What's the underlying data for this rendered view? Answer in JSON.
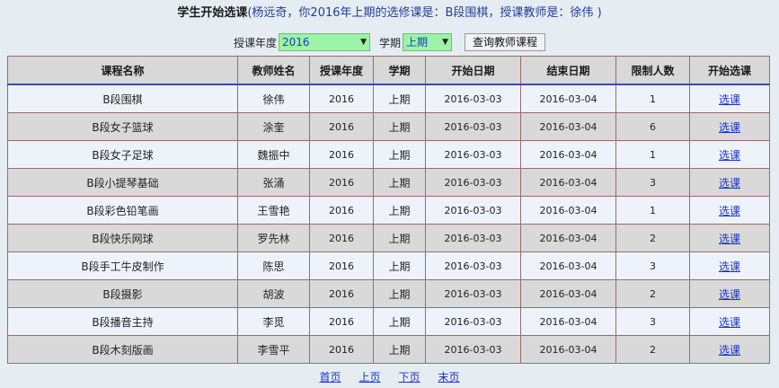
{
  "header": {
    "title": "学生开始选课",
    "note": "(杨远奇，你2016年上期的选修课是：B段围棋，授课教师是：徐伟 )"
  },
  "filters": {
    "year_label": "授课年度",
    "year_value": "2016",
    "term_label": "学期",
    "term_value": "上期",
    "query_button": "查询教师课程"
  },
  "table": {
    "columns": [
      "课程名称",
      "教师姓名",
      "授课年度",
      "学期",
      "开始日期",
      "结束日期",
      "限制人数",
      "开始选课"
    ],
    "rows": [
      {
        "course": "B段围棋",
        "teacher": "徐伟",
        "year": "2016",
        "term": "上期",
        "start": "2016-03-03",
        "end": "2016-03-04",
        "limit": "1",
        "action": "选课"
      },
      {
        "course": "B段女子篮球",
        "teacher": "涂奎",
        "year": "2016",
        "term": "上期",
        "start": "2016-03-03",
        "end": "2016-03-04",
        "limit": "6",
        "action": "选课"
      },
      {
        "course": "B段女子足球",
        "teacher": "魏振中",
        "year": "2016",
        "term": "上期",
        "start": "2016-03-03",
        "end": "2016-03-04",
        "limit": "1",
        "action": "选课"
      },
      {
        "course": "B段小提琴基础",
        "teacher": "张涌",
        "year": "2016",
        "term": "上期",
        "start": "2016-03-03",
        "end": "2016-03-04",
        "limit": "3",
        "action": "选课"
      },
      {
        "course": "B段彩色铅笔画",
        "teacher": "王雪艳",
        "year": "2016",
        "term": "上期",
        "start": "2016-03-03",
        "end": "2016-03-04",
        "limit": "1",
        "action": "选课"
      },
      {
        "course": "B段快乐网球",
        "teacher": "罗先林",
        "year": "2016",
        "term": "上期",
        "start": "2016-03-03",
        "end": "2016-03-04",
        "limit": "2",
        "action": "选课"
      },
      {
        "course": "B段手工牛皮制作",
        "teacher": "陈思",
        "year": "2016",
        "term": "上期",
        "start": "2016-03-03",
        "end": "2016-03-04",
        "limit": "3",
        "action": "选课"
      },
      {
        "course": "B段摄影",
        "teacher": "胡波",
        "year": "2016",
        "term": "上期",
        "start": "2016-03-03",
        "end": "2016-03-04",
        "limit": "2",
        "action": "选课"
      },
      {
        "course": "B段播音主持",
        "teacher": "李觅",
        "year": "2016",
        "term": "上期",
        "start": "2016-03-03",
        "end": "2016-03-04",
        "limit": "3",
        "action": "选课"
      },
      {
        "course": "B段木刻版画",
        "teacher": "李雪平",
        "year": "2016",
        "term": "上期",
        "start": "2016-03-03",
        "end": "2016-03-04",
        "limit": "2",
        "action": "选课"
      }
    ]
  },
  "pager": {
    "first": "首页",
    "prev": "上页",
    "next": "下页",
    "last": "末页"
  },
  "icons": {
    "dropdown": "chevron-down-icon"
  },
  "colors": {
    "select_bg": "#9cf2a6",
    "link": "#1a33cc",
    "header_rule": "#3a49b8"
  }
}
